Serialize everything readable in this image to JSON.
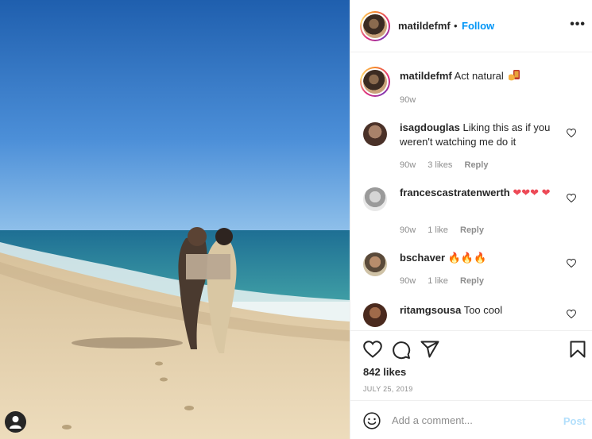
{
  "post": {
    "username": "matildefmf",
    "separator": "•",
    "follow_label": "Follow",
    "more_label": "•••"
  },
  "comments": [
    {
      "username": "matildefmf",
      "text": "Act natural",
      "emoji": "hand-with-phone",
      "time": "90w"
    },
    {
      "username": "isagdouglas",
      "text": "Liking this as if you weren't watching me do it",
      "time": "90w",
      "likes": "3 likes",
      "reply": "Reply"
    },
    {
      "username": "francescastratenwerth",
      "text": "❤❤❤ ❤",
      "time": "90w",
      "likes": "1 like",
      "reply": "Reply"
    },
    {
      "username": "bschaver",
      "text": "🔥🔥🔥",
      "time": "90w",
      "likes": "1 like",
      "reply": "Reply"
    },
    {
      "username": "ritamgsousa",
      "text": "Too cool"
    }
  ],
  "actions": {
    "likes": "842 likes",
    "date": "JULY 25, 2019"
  },
  "composer": {
    "placeholder": "Add a comment...",
    "post_label": "Post"
  },
  "colors": {
    "accent": "#0095f6",
    "post_disabled": "#b2dffc",
    "heart_red": "#ed4956"
  }
}
